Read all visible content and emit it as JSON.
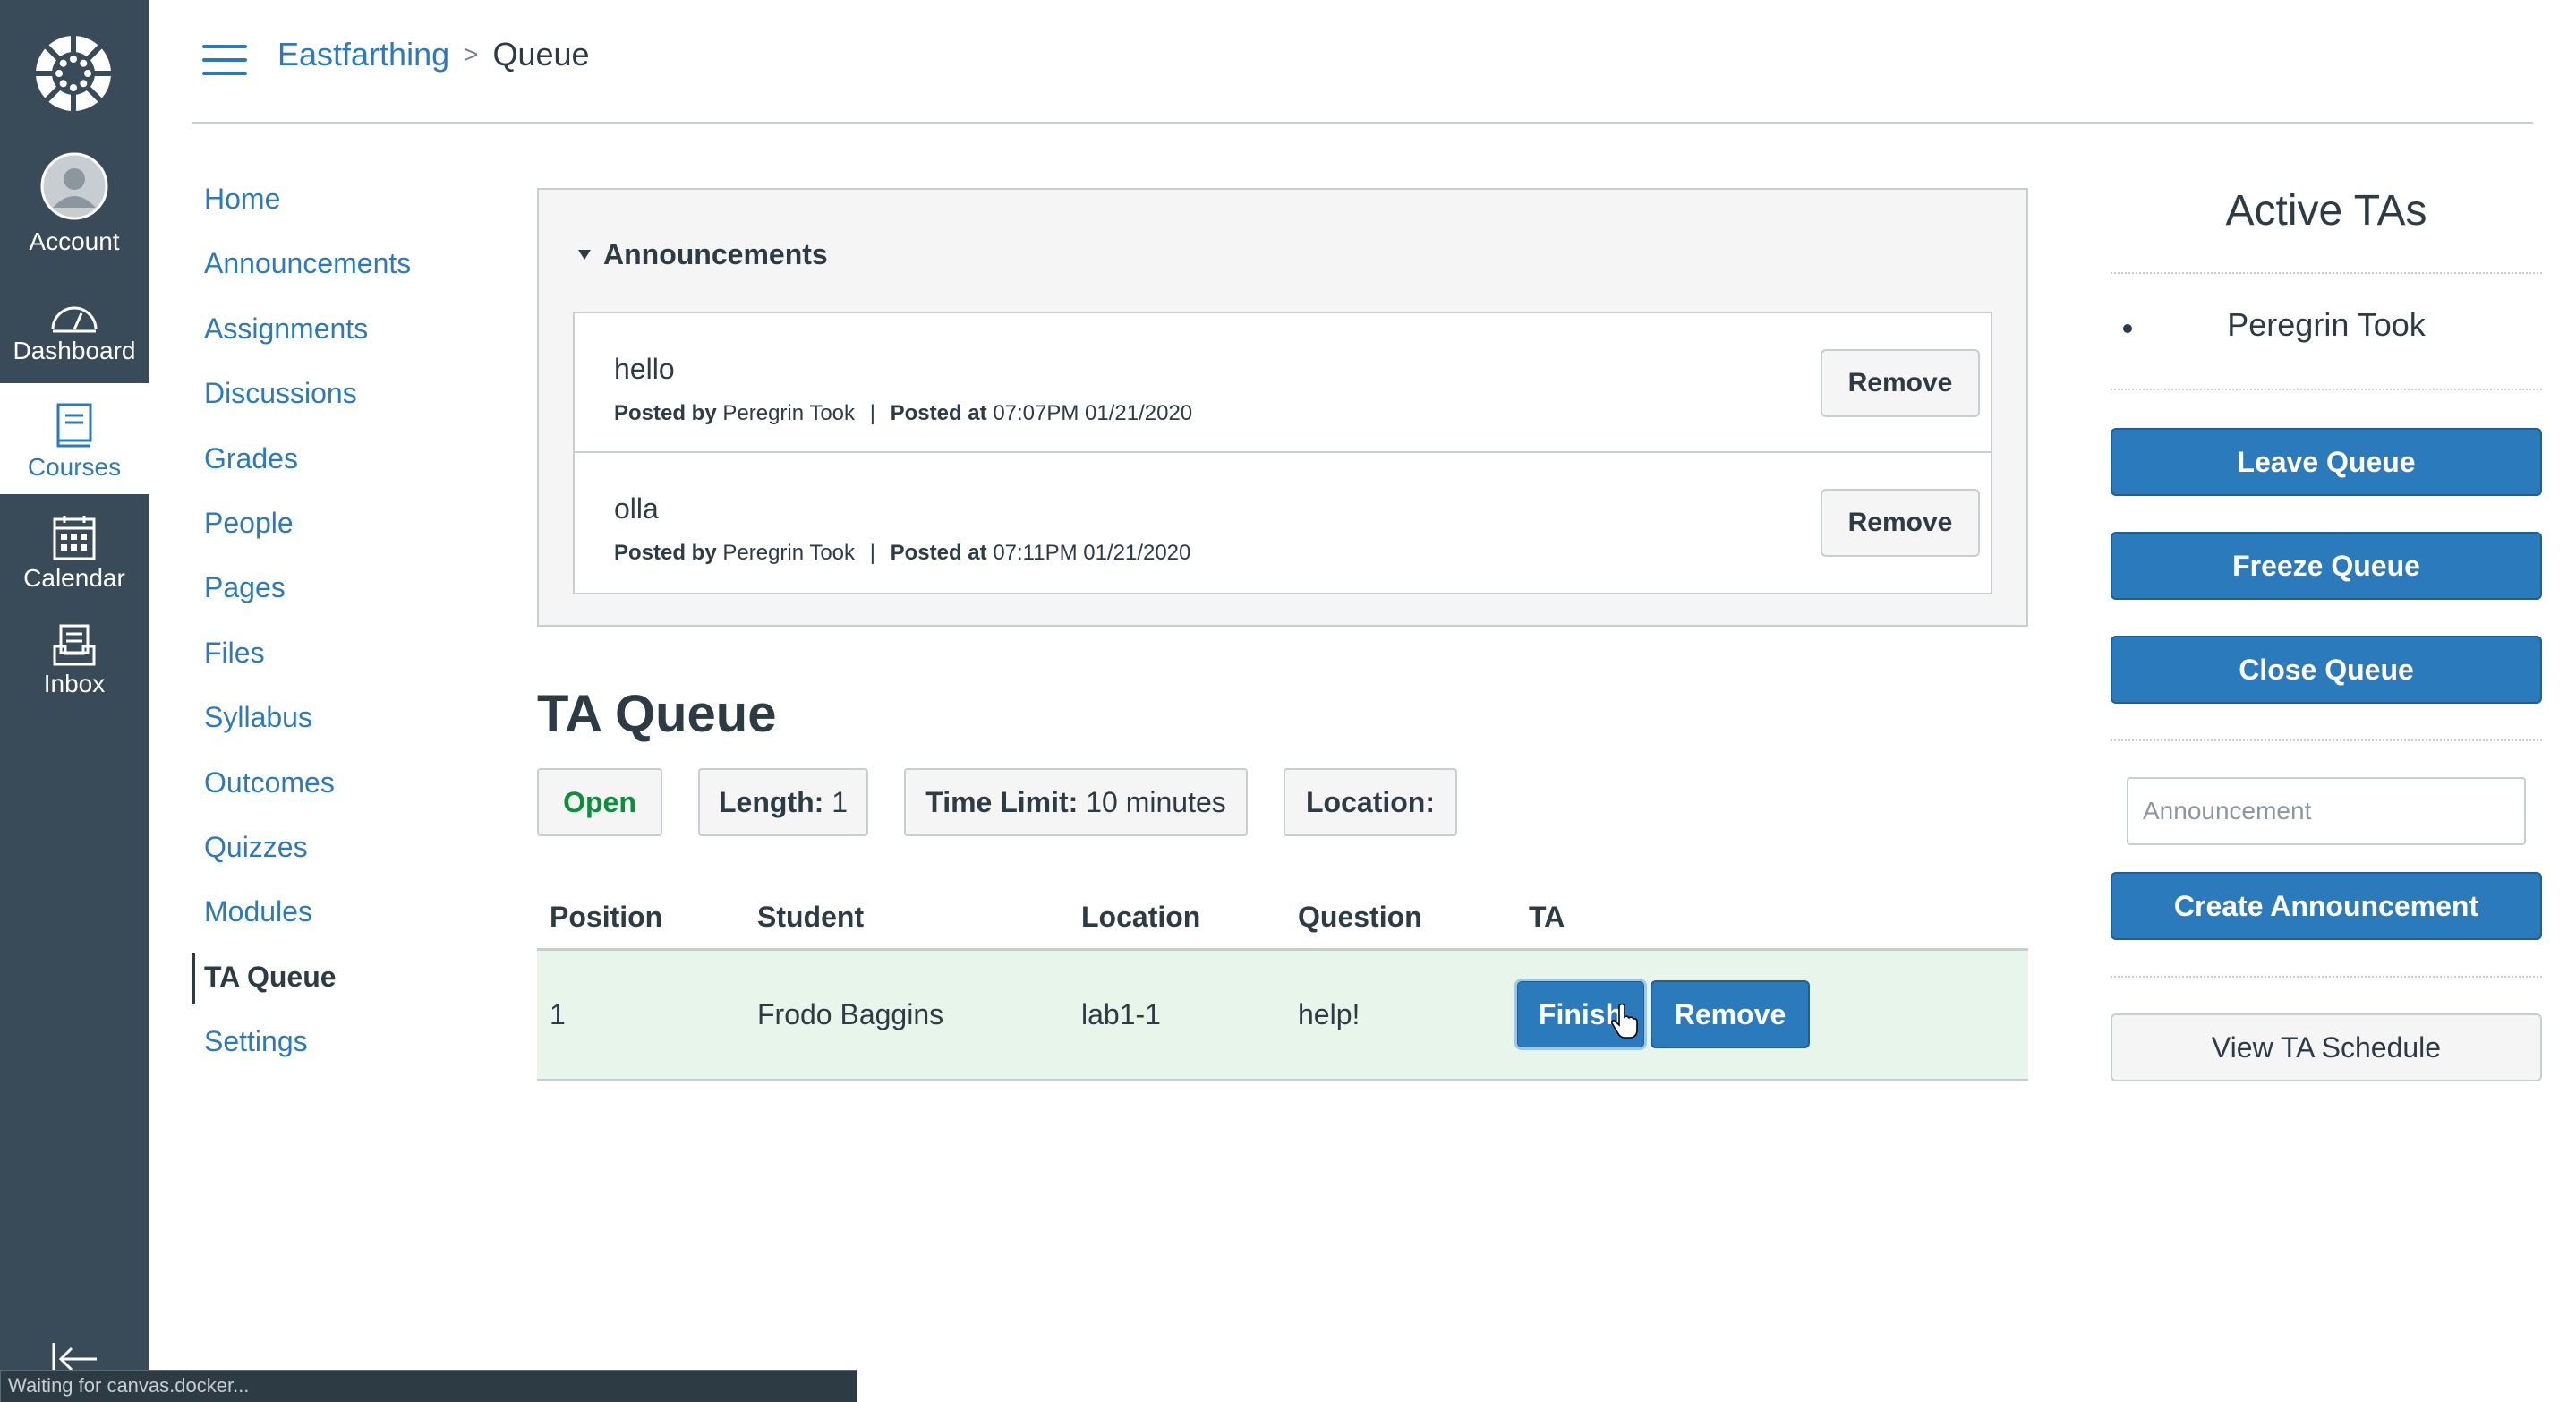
{
  "global_nav": {
    "logo_icon": "canvas-logo-icon",
    "items": [
      {
        "label": "Account",
        "icon": "avatar-icon"
      },
      {
        "label": "Dashboard",
        "icon": "dashboard-gauge-icon"
      },
      {
        "label": "Courses",
        "icon": "courses-book-icon"
      },
      {
        "label": "Calendar",
        "icon": "calendar-icon"
      },
      {
        "label": "Inbox",
        "icon": "inbox-icon"
      }
    ],
    "active": "Courses",
    "active_color": "#2b7abc",
    "background": "#394b58"
  },
  "header": {
    "course": "Eastfarthing",
    "separator": ">",
    "current": "Queue"
  },
  "course_nav": {
    "items": [
      "Home",
      "Announcements",
      "Assignments",
      "Discussions",
      "Grades",
      "People",
      "Pages",
      "Files",
      "Syllabus",
      "Outcomes",
      "Quizzes",
      "Modules",
      "TA Queue",
      "Settings"
    ],
    "active": "TA Queue"
  },
  "announcements": {
    "heading": "Announcements",
    "posted_by_label": "Posted by",
    "posted_at_label": "Posted at",
    "remove_label": "Remove",
    "items": [
      {
        "title": "hello",
        "author": "Peregrin Took",
        "time": "07:07PM 01/21/2020"
      },
      {
        "title": "olla",
        "author": "Peregrin Took",
        "time": "07:11PM 01/21/2020"
      }
    ]
  },
  "queue": {
    "title": "TA Queue",
    "status": "Open",
    "status_color": "#0b8f3a",
    "length_label": "Length:",
    "length_value": "1",
    "time_limit_label": "Time Limit:",
    "time_limit_value": "10 minutes",
    "location_label": "Location:",
    "location_value": "",
    "columns": [
      "Position",
      "Student",
      "Location",
      "Question",
      "TA"
    ],
    "rows": [
      {
        "position": "1",
        "student": "Frodo Baggins",
        "location": "lab1-1",
        "question": "help!",
        "finish_label": "Finish",
        "remove_label": "Remove"
      }
    ]
  },
  "right_panel": {
    "active_tas_title": "Active TAs",
    "tas": [
      "Peregrin Took"
    ],
    "leave_label": "Leave Queue",
    "freeze_label": "Freeze Queue",
    "close_label": "Close Queue",
    "announcement_placeholder": "Announcement",
    "create_announcement_label": "Create Announcement",
    "view_schedule_label": "View TA Schedule",
    "primary_color": "#2b7abc"
  },
  "status_bar": {
    "text": "Waiting for canvas.docker..."
  }
}
